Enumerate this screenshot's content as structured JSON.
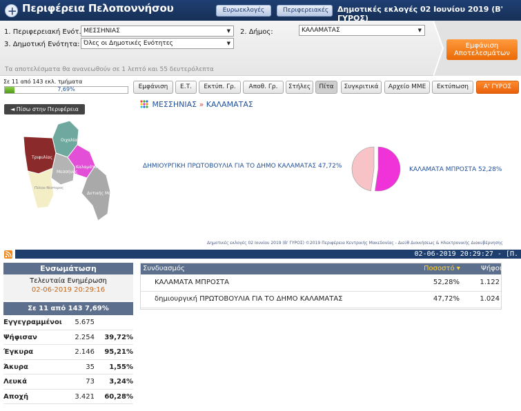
{
  "header": {
    "title": "Περιφέρεια Πελοποννήσου",
    "btn_euro": "Ευρωεκλογές",
    "btn_regional": "Περιφερειακές",
    "election_title": "Δημοτικές εκλογές 02 Ιουνίου 2019 (Β' ΓΥΡΟΣ)"
  },
  "filters": {
    "label_region": "1. Περιφερειακή Ενότ.:",
    "region_value": "ΜΕΣΣΗΝΙΑΣ",
    "label_municipality": "2. Δήμος:",
    "municipality_value": "ΚΑΛΑΜΑΤΑΣ",
    "label_unit": "3. Δημοτική Ενότητα:",
    "unit_value": "Όλες οι Δημοτικές Ενότητες",
    "show_results": "Εμφάνιση Αποτελεσμάτων",
    "update_notice": "Τα αποτελέσματα θα ανανεωθούν σε 1 λεπτό και 55 δευτερόλεπτα"
  },
  "progress": {
    "text": "Σε 11 από 143 εκλ. τμήματα",
    "percent_label": "7,69%",
    "fraction": 0.0769
  },
  "tabs": [
    "Εμφάνιση",
    "Ε.Τ.",
    "Εκτύπ. Γρ.",
    "Αποθ. Γρ.",
    "Στήλες",
    "Πίτα",
    "Συγκριτικά",
    "Αρχείο ΜΜΕ",
    "Εκτύπωση",
    "Α' ΓΥΡΟΣ"
  ],
  "back_button": "◄ Πίσω στην Περιφέρεια",
  "map_labels": {
    "a": "Τριφυλίας",
    "b": "Οιχαλίας",
    "c": "Καλαμάτας",
    "d": "Μεσσήνης",
    "e": "Πύλου-Νέστορος",
    "f": "Δυτικής Μάνης"
  },
  "breadcrumb": {
    "region": "ΜΕΣΣΗΝΙΑΣ",
    "sep": "»",
    "municipality": "ΚΑΛΑΜΑΤΑΣ"
  },
  "pie": {
    "label_left": "ΔΗΜΙΟΥΡΓΙΚΗ ΠΡΩΤΟΒΟΥΛΙΑ ΓΙΑ ΤΟ ΔΗΜΟ ΚΑΛΑΜΑΤΑΣ 47,72%",
    "label_right": "ΚΑΛΑΜΑΤΑ ΜΠΡΟΣΤΑ 52,28%",
    "share_right": 52.28,
    "share_left": 47.72,
    "color_right": "#f033d8",
    "color_left": "#f7c3c6"
  },
  "footnote": "Δημοτικές εκλογές 02 Ιουνίου 2019 (Β' ΓΥΡΟΣ) ©2019 Περιφέρεια Κεντρικής Μακεδονίας - Διεύθ Διοικήσεως & Ηλεκτρονικής Διακυβέρνησης",
  "datebar": "02-06-2019 20:29:27 - [Π.",
  "summary": {
    "header": "Ενσωμάτωση",
    "last_update_label": "Τελευταία Ενημέρωση",
    "last_update_value": "02-06-2019 20:29:16",
    "count": "Σε 11 από  143   7,69%",
    "rows": [
      {
        "label": "Εγγεγραμμένοι",
        "value": "5.675",
        "pct": ""
      },
      {
        "label": "Ψήφισαν",
        "value": "2.254",
        "pct": "39,72%"
      },
      {
        "label": "Έγκυρα",
        "value": "2.146",
        "pct": "95,21%"
      },
      {
        "label": "Άκυρα",
        "value": "35",
        "pct": "1,55%"
      },
      {
        "label": "Λευκά",
        "value": "73",
        "pct": "3,24%"
      },
      {
        "label": "Αποχή",
        "value": "3.421",
        "pct": "60,28%"
      }
    ]
  },
  "results": {
    "col_name": "Συνδυασμός",
    "col_pct": "Ποσοστό ▾",
    "col_votes": "Ψήφοι",
    "rows": [
      {
        "name": "ΚΑΛΑΜΑΤΑ ΜΠΡΟΣΤΑ",
        "pct": "52,28%",
        "votes": "1.122"
      },
      {
        "name": "δημιουργική ΠΡΩΤΟΒΟΥΛΙΑ ΓΙΑ ΤΟ ΔΗΜΟ ΚΑΛΑΜΑΤΑΣ",
        "pct": "47,72%",
        "votes": "1.024"
      }
    ]
  }
}
